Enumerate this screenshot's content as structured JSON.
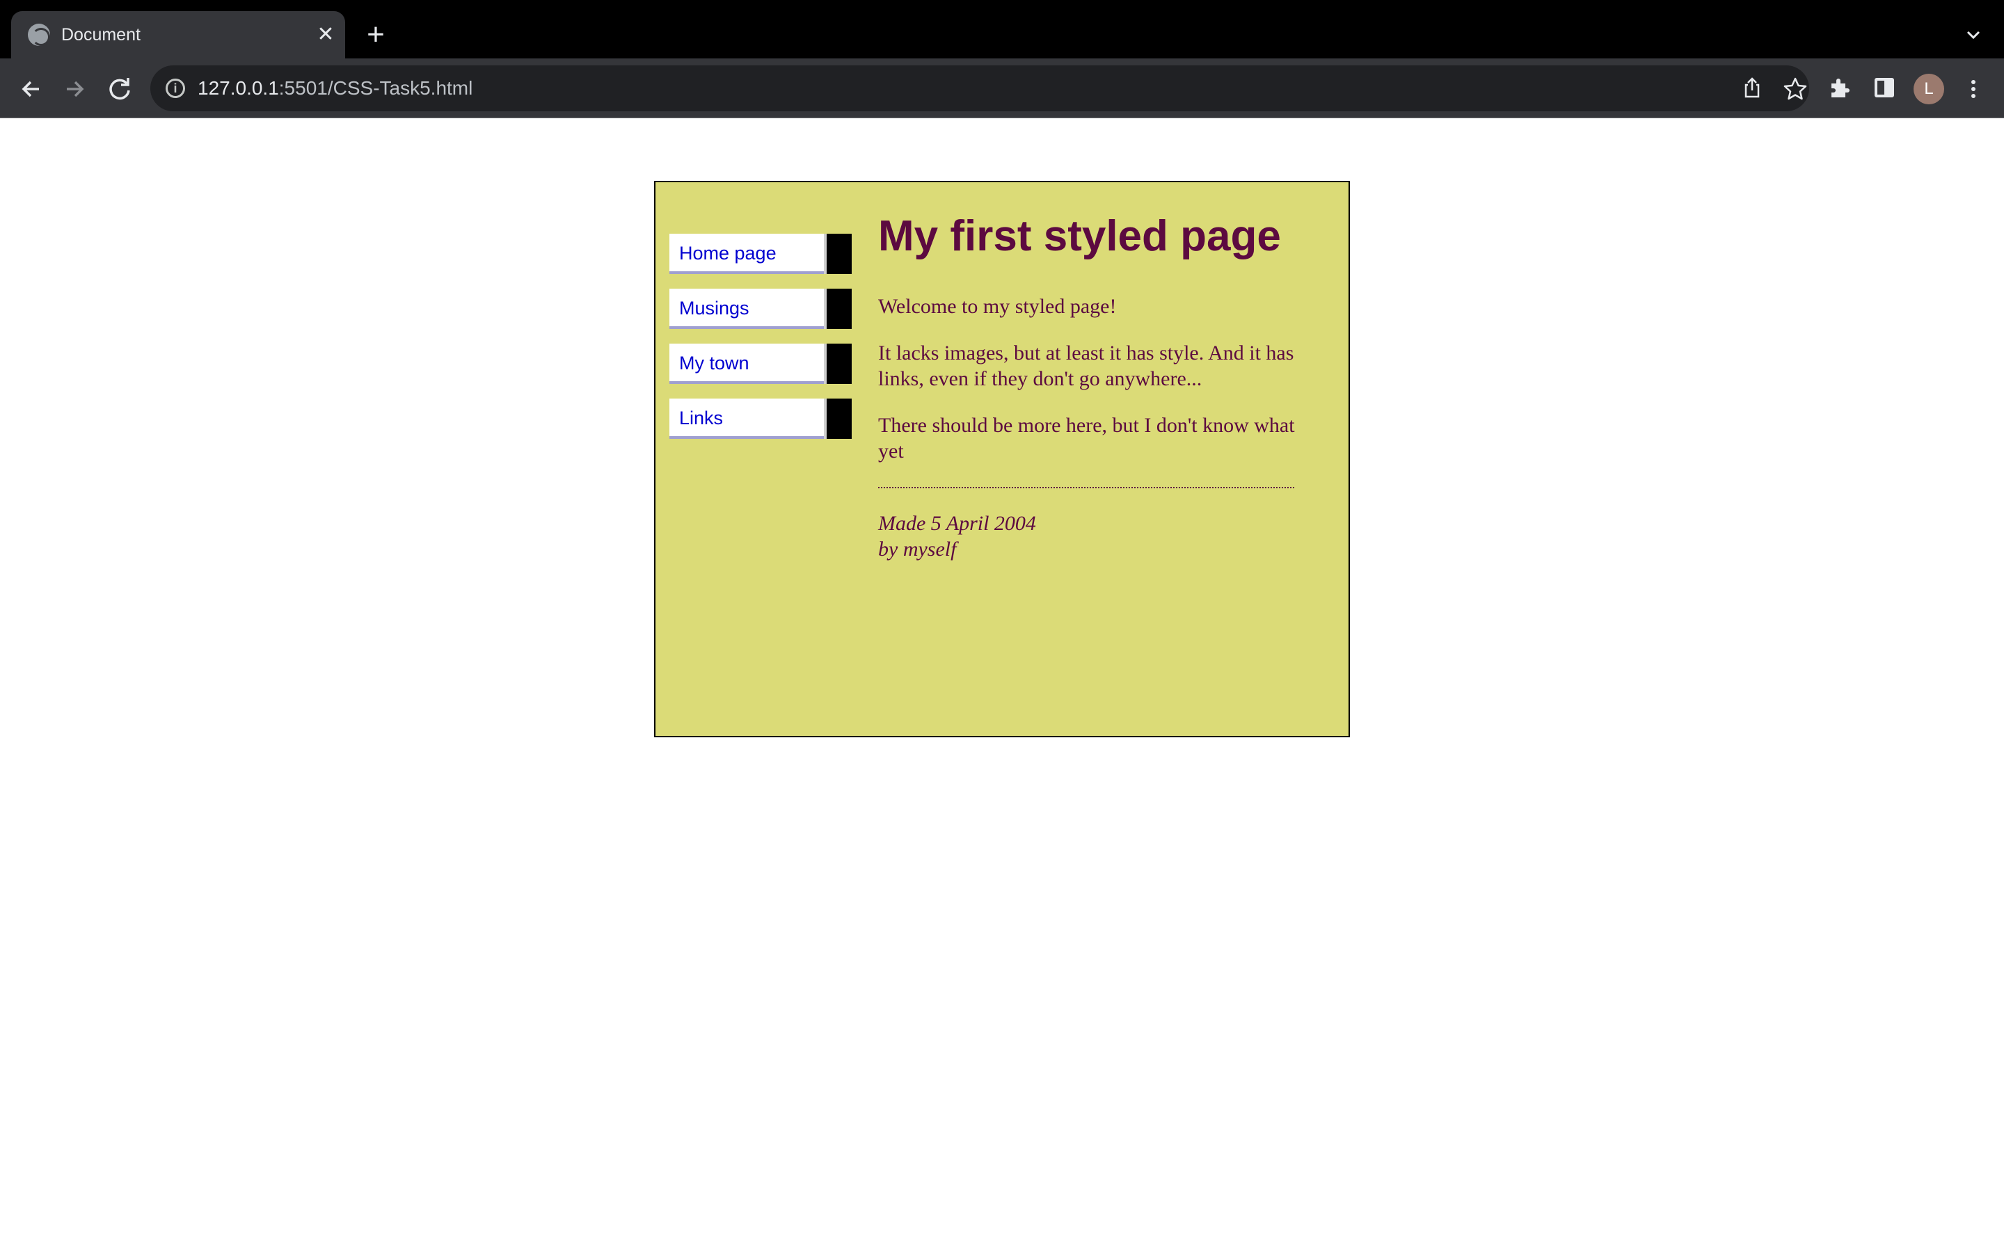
{
  "browser": {
    "tab_title": "Document",
    "tab_close": "✕",
    "new_tab": "+",
    "tab_menu": "⌄",
    "url_host": "127.0.0.1",
    "url_rest": ":5501/CSS-Task5.html",
    "avatar_initial": "L",
    "icons": [
      "globe-icon",
      "close-icon",
      "plus-icon",
      "chevron-down-icon",
      "back-arrow-icon",
      "forward-arrow-icon",
      "reload-icon",
      "info-icon",
      "share-icon",
      "star-icon",
      "extensions-icon",
      "side-panel-icon",
      "avatar",
      "kebab-menu-icon"
    ]
  },
  "page": {
    "nav": [
      {
        "label": "Home page"
      },
      {
        "label": "Musings"
      },
      {
        "label": "My town"
      },
      {
        "label": "Links"
      }
    ],
    "title": "My first styled page",
    "paragraphs": [
      "Welcome to my styled page!",
      "It lacks images, but at least it has style. And it has links, even if they don't go anywhere...",
      "There should be more here, but I don't know what yet"
    ],
    "signature_line1": "Made 5 April 2004",
    "signature_line2": "by myself"
  },
  "colors": {
    "page_bg": "#dbdb77",
    "text": "#5c0a40",
    "link": "#0000d0",
    "chrome_dark": "#35363a"
  }
}
